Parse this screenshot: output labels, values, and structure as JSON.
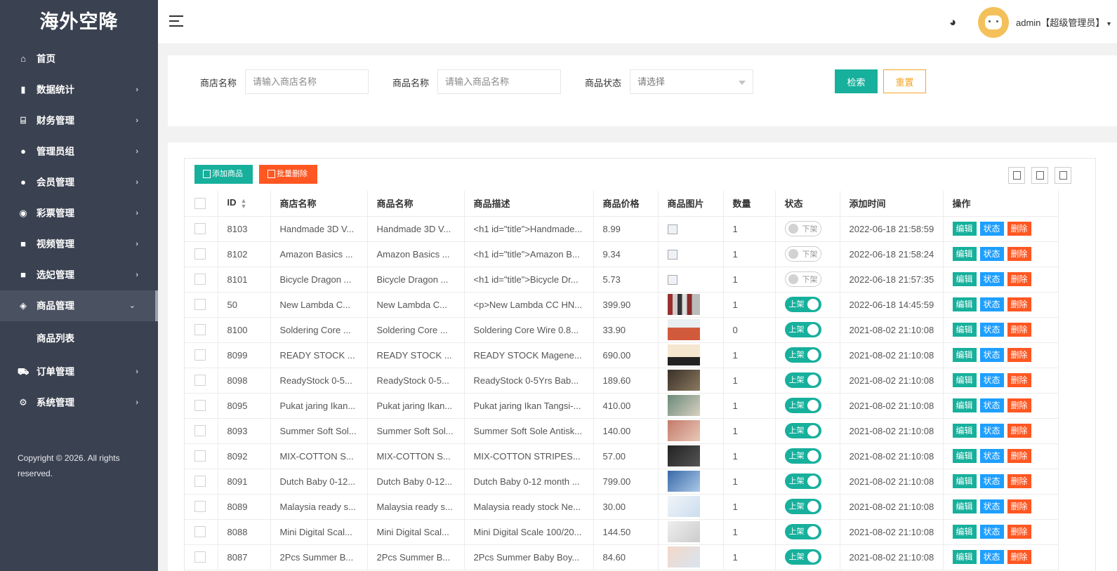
{
  "brand": {
    "title": "海外空降"
  },
  "sidebar": {
    "items": [
      {
        "label": "首页",
        "icon": "home-icon",
        "glyph": "⌂",
        "arrow": false
      },
      {
        "label": "数据统计",
        "icon": "bar-chart-icon",
        "glyph": "▮",
        "arrow": true
      },
      {
        "label": "财务管理",
        "icon": "bank-icon",
        "glyph": "⌸",
        "arrow": true
      },
      {
        "label": "管理员组",
        "icon": "user-icon",
        "glyph": "●",
        "arrow": true
      },
      {
        "label": "会员管理",
        "icon": "users-icon",
        "glyph": "●",
        "arrow": true
      },
      {
        "label": "彩票管理",
        "icon": "gamepad-icon",
        "glyph": "◉",
        "arrow": true
      },
      {
        "label": "视频管理",
        "icon": "video-icon",
        "glyph": "■",
        "arrow": true
      },
      {
        "label": "选妃管理",
        "icon": "video-icon",
        "glyph": "■",
        "arrow": true
      },
      {
        "label": "商品管理",
        "icon": "cube-icon",
        "glyph": "◈",
        "arrow": true,
        "active": true
      },
      {
        "label": "订单管理",
        "icon": "cart-icon",
        "glyph": "⛟",
        "arrow": true
      },
      {
        "label": "系统管理",
        "icon": "gear-icon",
        "glyph": "⚙",
        "arrow": true
      }
    ],
    "sub_item": "商品列表",
    "copyright": "Copyright © 2026. All rights reserved."
  },
  "header": {
    "admin": "admin【超级管理员】",
    "palette_icon": "palette-icon"
  },
  "search": {
    "shop_label": "商店名称",
    "shop_placeholder": "请输入商店名称",
    "goods_label": "商品名称",
    "goods_placeholder": "请输入商品名称",
    "status_label": "商品状态",
    "status_value": "请选择",
    "search_btn": "检索",
    "reset_btn": "重置"
  },
  "toolbar": {
    "add": "添加商品",
    "batch_delete": "批量删除"
  },
  "table": {
    "columns": [
      "ID",
      "商店名称",
      "商品名称",
      "商品描述",
      "商品价格",
      "商品图片",
      "数量",
      "状态",
      "添加时间",
      "操作"
    ],
    "rows": [
      {
        "id": "8103",
        "shop": "Handmade 3D V...",
        "name": "Handmade 3D V...",
        "desc": "<h1 id=\"title\">Handmade...",
        "price": "8.99",
        "qty": "1",
        "status": "下架",
        "time": "2022-06-18 21:58:59"
      },
      {
        "id": "8102",
        "shop": "Amazon Basics ...",
        "name": "Amazon Basics ...",
        "desc": "<h1 id=\"title\">Amazon B...",
        "price": "9.34",
        "qty": "1",
        "status": "下架",
        "time": "2022-06-18 21:58:24"
      },
      {
        "id": "8101",
        "shop": "Bicycle Dragon ...",
        "name": "Bicycle Dragon ...",
        "desc": "<h1 id=\"title\">Bicycle Dr...",
        "price": "5.73",
        "qty": "1",
        "status": "下架",
        "time": "2022-06-18 21:57:35"
      },
      {
        "id": "50",
        "shop": "New Lambda C...",
        "name": "New Lambda C...",
        "desc": "<p>New Lambda CC HN...",
        "price": "399.90",
        "qty": "1",
        "status": "上架",
        "time": "2022-06-18 14:45:59"
      },
      {
        "id": "8100",
        "shop": "Soldering Core ...",
        "name": "Soldering Core ...",
        "desc": "Soldering Core Wire 0.8...",
        "price": "33.90",
        "qty": "0",
        "status": "上架",
        "time": "2021-08-02 21:10:08"
      },
      {
        "id": "8099",
        "shop": "READY STOCK ...",
        "name": "READY STOCK ...",
        "desc": "READY STOCK Magene...",
        "price": "690.00",
        "qty": "1",
        "status": "上架",
        "time": "2021-08-02 21:10:08"
      },
      {
        "id": "8098",
        "shop": "ReadyStock 0-5...",
        "name": "ReadyStock 0-5...",
        "desc": "ReadyStock 0-5Yrs Bab...",
        "price": "189.60",
        "qty": "1",
        "status": "上架",
        "time": "2021-08-02 21:10:08"
      },
      {
        "id": "8095",
        "shop": "Pukat jaring Ikan...",
        "name": "Pukat jaring Ikan...",
        "desc": "Pukat jaring Ikan Tangsi-...",
        "price": "410.00",
        "qty": "1",
        "status": "上架",
        "time": "2021-08-02 21:10:08"
      },
      {
        "id": "8093",
        "shop": "Summer Soft Sol...",
        "name": "Summer Soft Sol...",
        "desc": "Summer Soft Sole Antisk...",
        "price": "140.00",
        "qty": "1",
        "status": "上架",
        "time": "2021-08-02 21:10:08"
      },
      {
        "id": "8092",
        "shop": "MIX-COTTON S...",
        "name": "MIX-COTTON S...",
        "desc": "MIX-COTTON STRIPES...",
        "price": "57.00",
        "qty": "1",
        "status": "上架",
        "time": "2021-08-02 21:10:08"
      },
      {
        "id": "8091",
        "shop": "Dutch Baby 0-12...",
        "name": "Dutch Baby 0-12...",
        "desc": "Dutch Baby 0-12 month ...",
        "price": "799.00",
        "qty": "1",
        "status": "上架",
        "time": "2021-08-02 21:10:08"
      },
      {
        "id": "8089",
        "shop": "Malaysia ready s...",
        "name": "Malaysia ready s...",
        "desc": "Malaysia ready stock Ne...",
        "price": "30.00",
        "qty": "1",
        "status": "上架",
        "time": "2021-08-02 21:10:08"
      },
      {
        "id": "8088",
        "shop": "Mini Digital Scal...",
        "name": "Mini Digital Scal...",
        "desc": "Mini Digital Scale 100/20...",
        "price": "144.50",
        "qty": "1",
        "status": "上架",
        "time": "2021-08-02 21:10:08"
      },
      {
        "id": "8087",
        "shop": "2Pcs Summer B...",
        "name": "2Pcs Summer B...",
        "desc": "2Pcs Summer Baby Boy...",
        "price": "84.60",
        "qty": "1",
        "status": "上架",
        "time": "2021-08-02 21:10:08"
      }
    ],
    "actions": {
      "edit": "编辑",
      "state": "状态",
      "delete": "删除"
    }
  },
  "colors": {
    "teal": "#17b09c",
    "blue": "#1e9fff",
    "red": "#ff5722",
    "orange": "#f5a524",
    "sidebar": "#3a4150"
  }
}
